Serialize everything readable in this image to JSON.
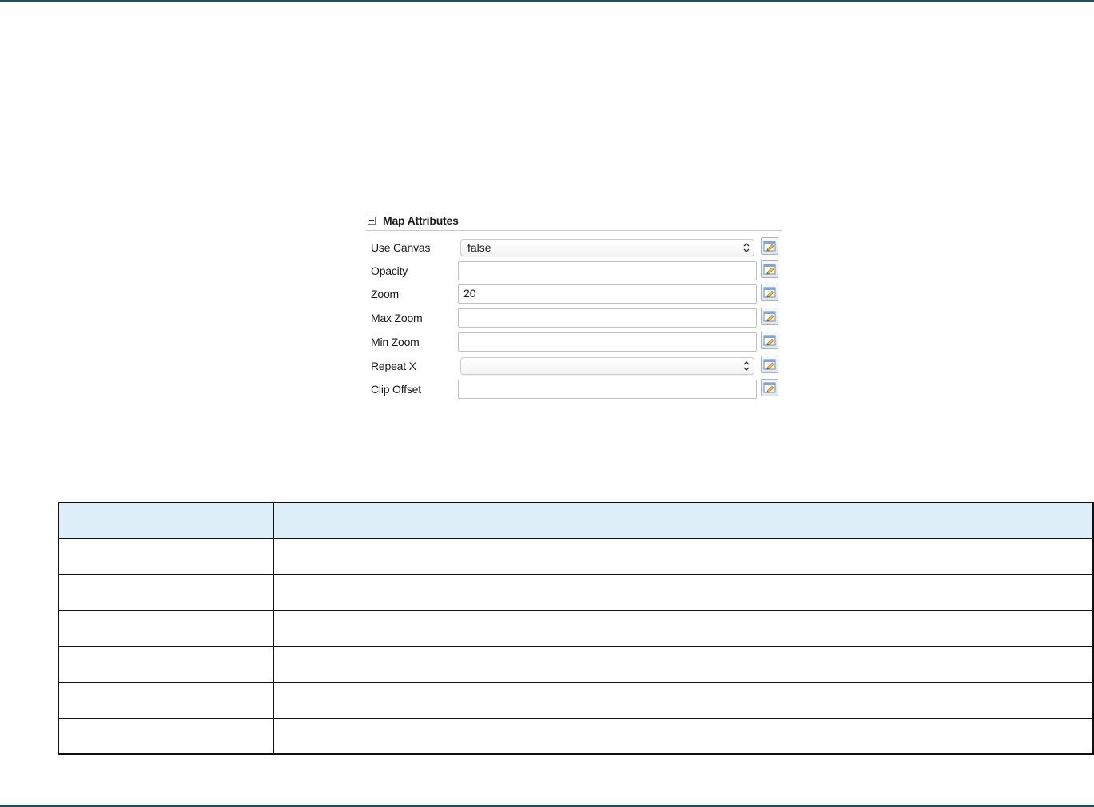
{
  "panel": {
    "title": "Map Attributes",
    "rows": [
      {
        "label": "Use Canvas",
        "type": "select",
        "value": "false"
      },
      {
        "label": "Opacity",
        "type": "text",
        "value": ""
      },
      {
        "label": "Zoom",
        "type": "text",
        "value": "20"
      },
      {
        "label": "Max Zoom",
        "type": "text",
        "value": ""
      },
      {
        "label": "Min Zoom",
        "type": "text",
        "value": ""
      },
      {
        "label": "Repeat X",
        "type": "select",
        "value": ""
      },
      {
        "label": "Clip Offset",
        "type": "text",
        "value": ""
      }
    ]
  },
  "table": {
    "headers": [
      "",
      ""
    ],
    "rows": [
      [
        "",
        ""
      ],
      [
        "",
        ""
      ],
      [
        "",
        ""
      ],
      [
        "",
        ""
      ],
      [
        "",
        ""
      ],
      [
        "",
        ""
      ]
    ]
  },
  "colors": {
    "rule": "#1f4e5f",
    "table_header_bg": "#ddeef9",
    "table_border": "#111111"
  },
  "icons": {
    "collapse": "minus-square-icon",
    "select_arrows": "chevron-updown-icon",
    "edit": "edit-property-icon"
  }
}
